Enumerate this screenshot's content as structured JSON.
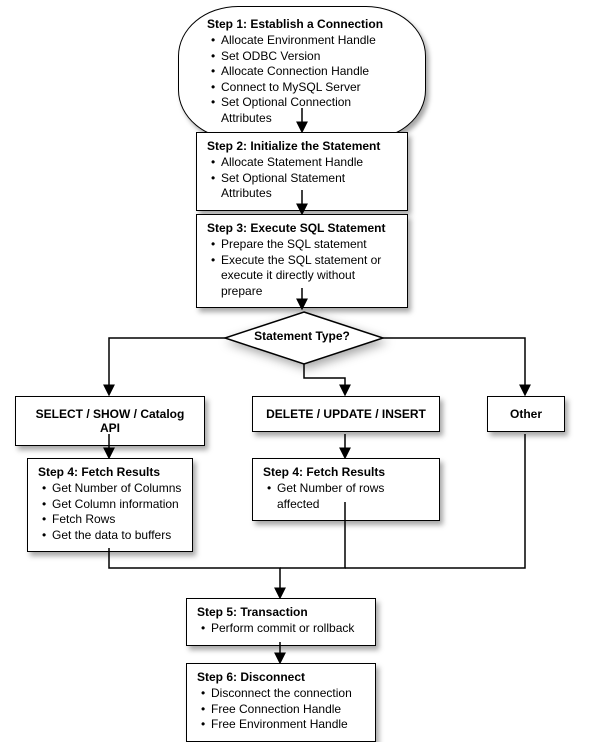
{
  "chart_data": {
    "type": "flowchart",
    "nodes": [
      {
        "id": "step1",
        "shape": "terminator",
        "title": "Step 1: Establish a Connection",
        "bullets": [
          "Allocate Environment Handle",
          "Set ODBC Version",
          "Allocate Connection Handle",
          "Connect to MySQL Server",
          "Set Optional Connection Attributes"
        ]
      },
      {
        "id": "step2",
        "shape": "process",
        "title": "Step 2: Initialize the Statement",
        "bullets": [
          "Allocate Statement Handle",
          "Set Optional Statement Attributes"
        ]
      },
      {
        "id": "step3",
        "shape": "process",
        "title": "Step 3: Execute SQL Statement",
        "bullets": [
          "Prepare the SQL statement",
          "Execute the SQL statement or execute it directly without prepare"
        ]
      },
      {
        "id": "decision",
        "shape": "decision",
        "label": "Statement Type?"
      },
      {
        "id": "branch_select",
        "shape": "process",
        "label": "SELECT / SHOW / Catalog API"
      },
      {
        "id": "branch_dml",
        "shape": "process",
        "label": "DELETE / UPDATE / INSERT"
      },
      {
        "id": "branch_other",
        "shape": "process",
        "label": "Other"
      },
      {
        "id": "step4a",
        "shape": "process",
        "title": "Step 4: Fetch Results",
        "bullets": [
          "Get Number of Columns",
          "Get Column information",
          "Fetch Rows",
          "Get the data to buffers"
        ]
      },
      {
        "id": "step4b",
        "shape": "process",
        "title": "Step 4: Fetch Results",
        "bullets": [
          "Get Number of rows affected"
        ]
      },
      {
        "id": "step5",
        "shape": "process",
        "title": "Step 5: Transaction",
        "bullets": [
          "Perform commit or rollback"
        ]
      },
      {
        "id": "step6",
        "shape": "process",
        "title": "Step 6: Disconnect",
        "bullets": [
          "Disconnect the connection",
          "Free Connection Handle",
          "Free Environment Handle"
        ]
      }
    ],
    "edges": [
      {
        "from": "step1",
        "to": "step2"
      },
      {
        "from": "step2",
        "to": "step3"
      },
      {
        "from": "step3",
        "to": "decision"
      },
      {
        "from": "decision",
        "to": "branch_select"
      },
      {
        "from": "decision",
        "to": "branch_dml"
      },
      {
        "from": "decision",
        "to": "branch_other"
      },
      {
        "from": "branch_select",
        "to": "step4a"
      },
      {
        "from": "branch_dml",
        "to": "step4b"
      },
      {
        "from": "step4a",
        "to": "step5"
      },
      {
        "from": "step4b",
        "to": "step5"
      },
      {
        "from": "branch_other",
        "to": "step5"
      },
      {
        "from": "step5",
        "to": "step6"
      }
    ]
  }
}
